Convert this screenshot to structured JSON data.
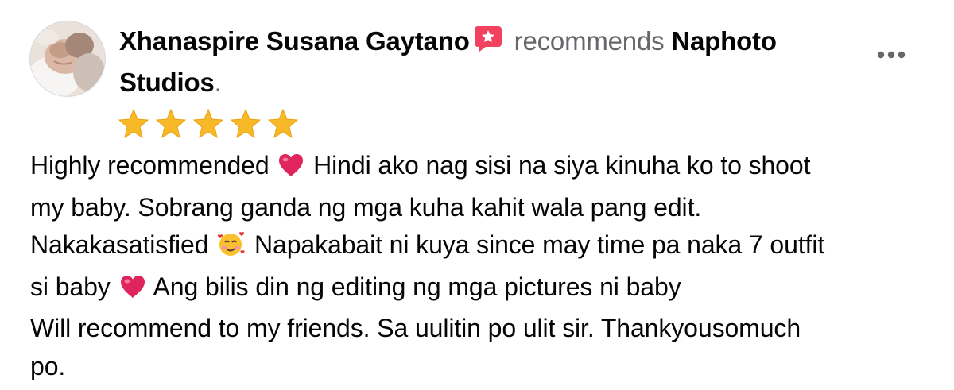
{
  "review": {
    "author": "Xhanaspire Susana Gaytano",
    "verb": "recommends",
    "page_name_line1": "Naphoto",
    "page_name_line2": "Studios",
    "period": ".",
    "rating_stars": 5,
    "icons": {
      "badge": "recommendation-speech-badge-icon",
      "more": "more-options-icon",
      "star": "star-icon",
      "heart": "red-heart-emoji",
      "smiling_face_hearts": "smiling-face-with-hearts-emoji"
    },
    "colors": {
      "badge": "#f3425f",
      "star": "#f7b928",
      "heart": "#e0245e",
      "secondary_text": "#65676b"
    },
    "body": {
      "l1a": "Highly recommended",
      "l1b": "Hindi ako nag sisi na siya kinuha ko to shoot",
      "l2": "my baby. Sobrang ganda ng mga kuha kahit wala pang edit.",
      "l3a": "Nakakasatisfied",
      "l3b": "Napakabait ni kuya since may time pa naka 7 outfit",
      "l4a": "si baby",
      "l4b": "Ang bilis din ng editing ng mga pictures ni baby",
      "l5": "Will recommend to my friends. Sa uulitin po ulit sir. Thankyousomuch",
      "l6": "po."
    }
  }
}
